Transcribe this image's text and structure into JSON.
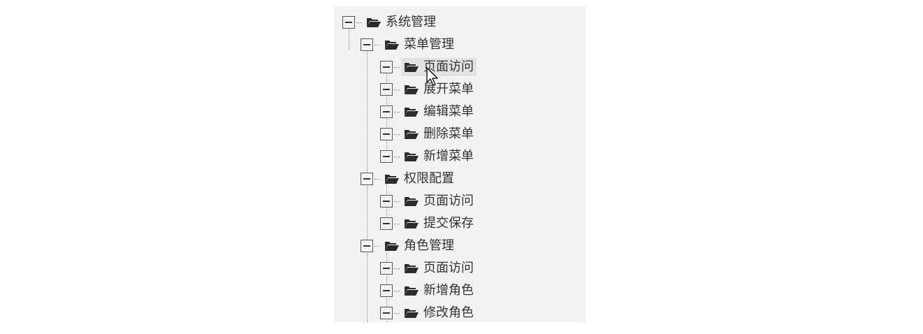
{
  "tree": {
    "root": {
      "label": "系统管理",
      "children": [
        {
          "label": "菜单管理",
          "children": [
            {
              "label": "页面访问"
            },
            {
              "label": "展开菜单"
            },
            {
              "label": "编辑菜单"
            },
            {
              "label": "删除菜单"
            },
            {
              "label": "新增菜单"
            }
          ]
        },
        {
          "label": "权限配置",
          "children": [
            {
              "label": "页面访问"
            },
            {
              "label": "提交保存"
            }
          ]
        },
        {
          "label": "角色管理",
          "children": [
            {
              "label": "页面访问"
            },
            {
              "label": "新增角色"
            },
            {
              "label": "修改角色"
            }
          ]
        }
      ]
    }
  },
  "icons": {
    "toggle": "collapse-minus-icon",
    "node": "folder-open-icon"
  },
  "colors": {
    "panel_bg": "#f2f2f2",
    "hover_bg": "#e2e2e2",
    "text": "#333333",
    "folder": "#2b2b2b"
  }
}
